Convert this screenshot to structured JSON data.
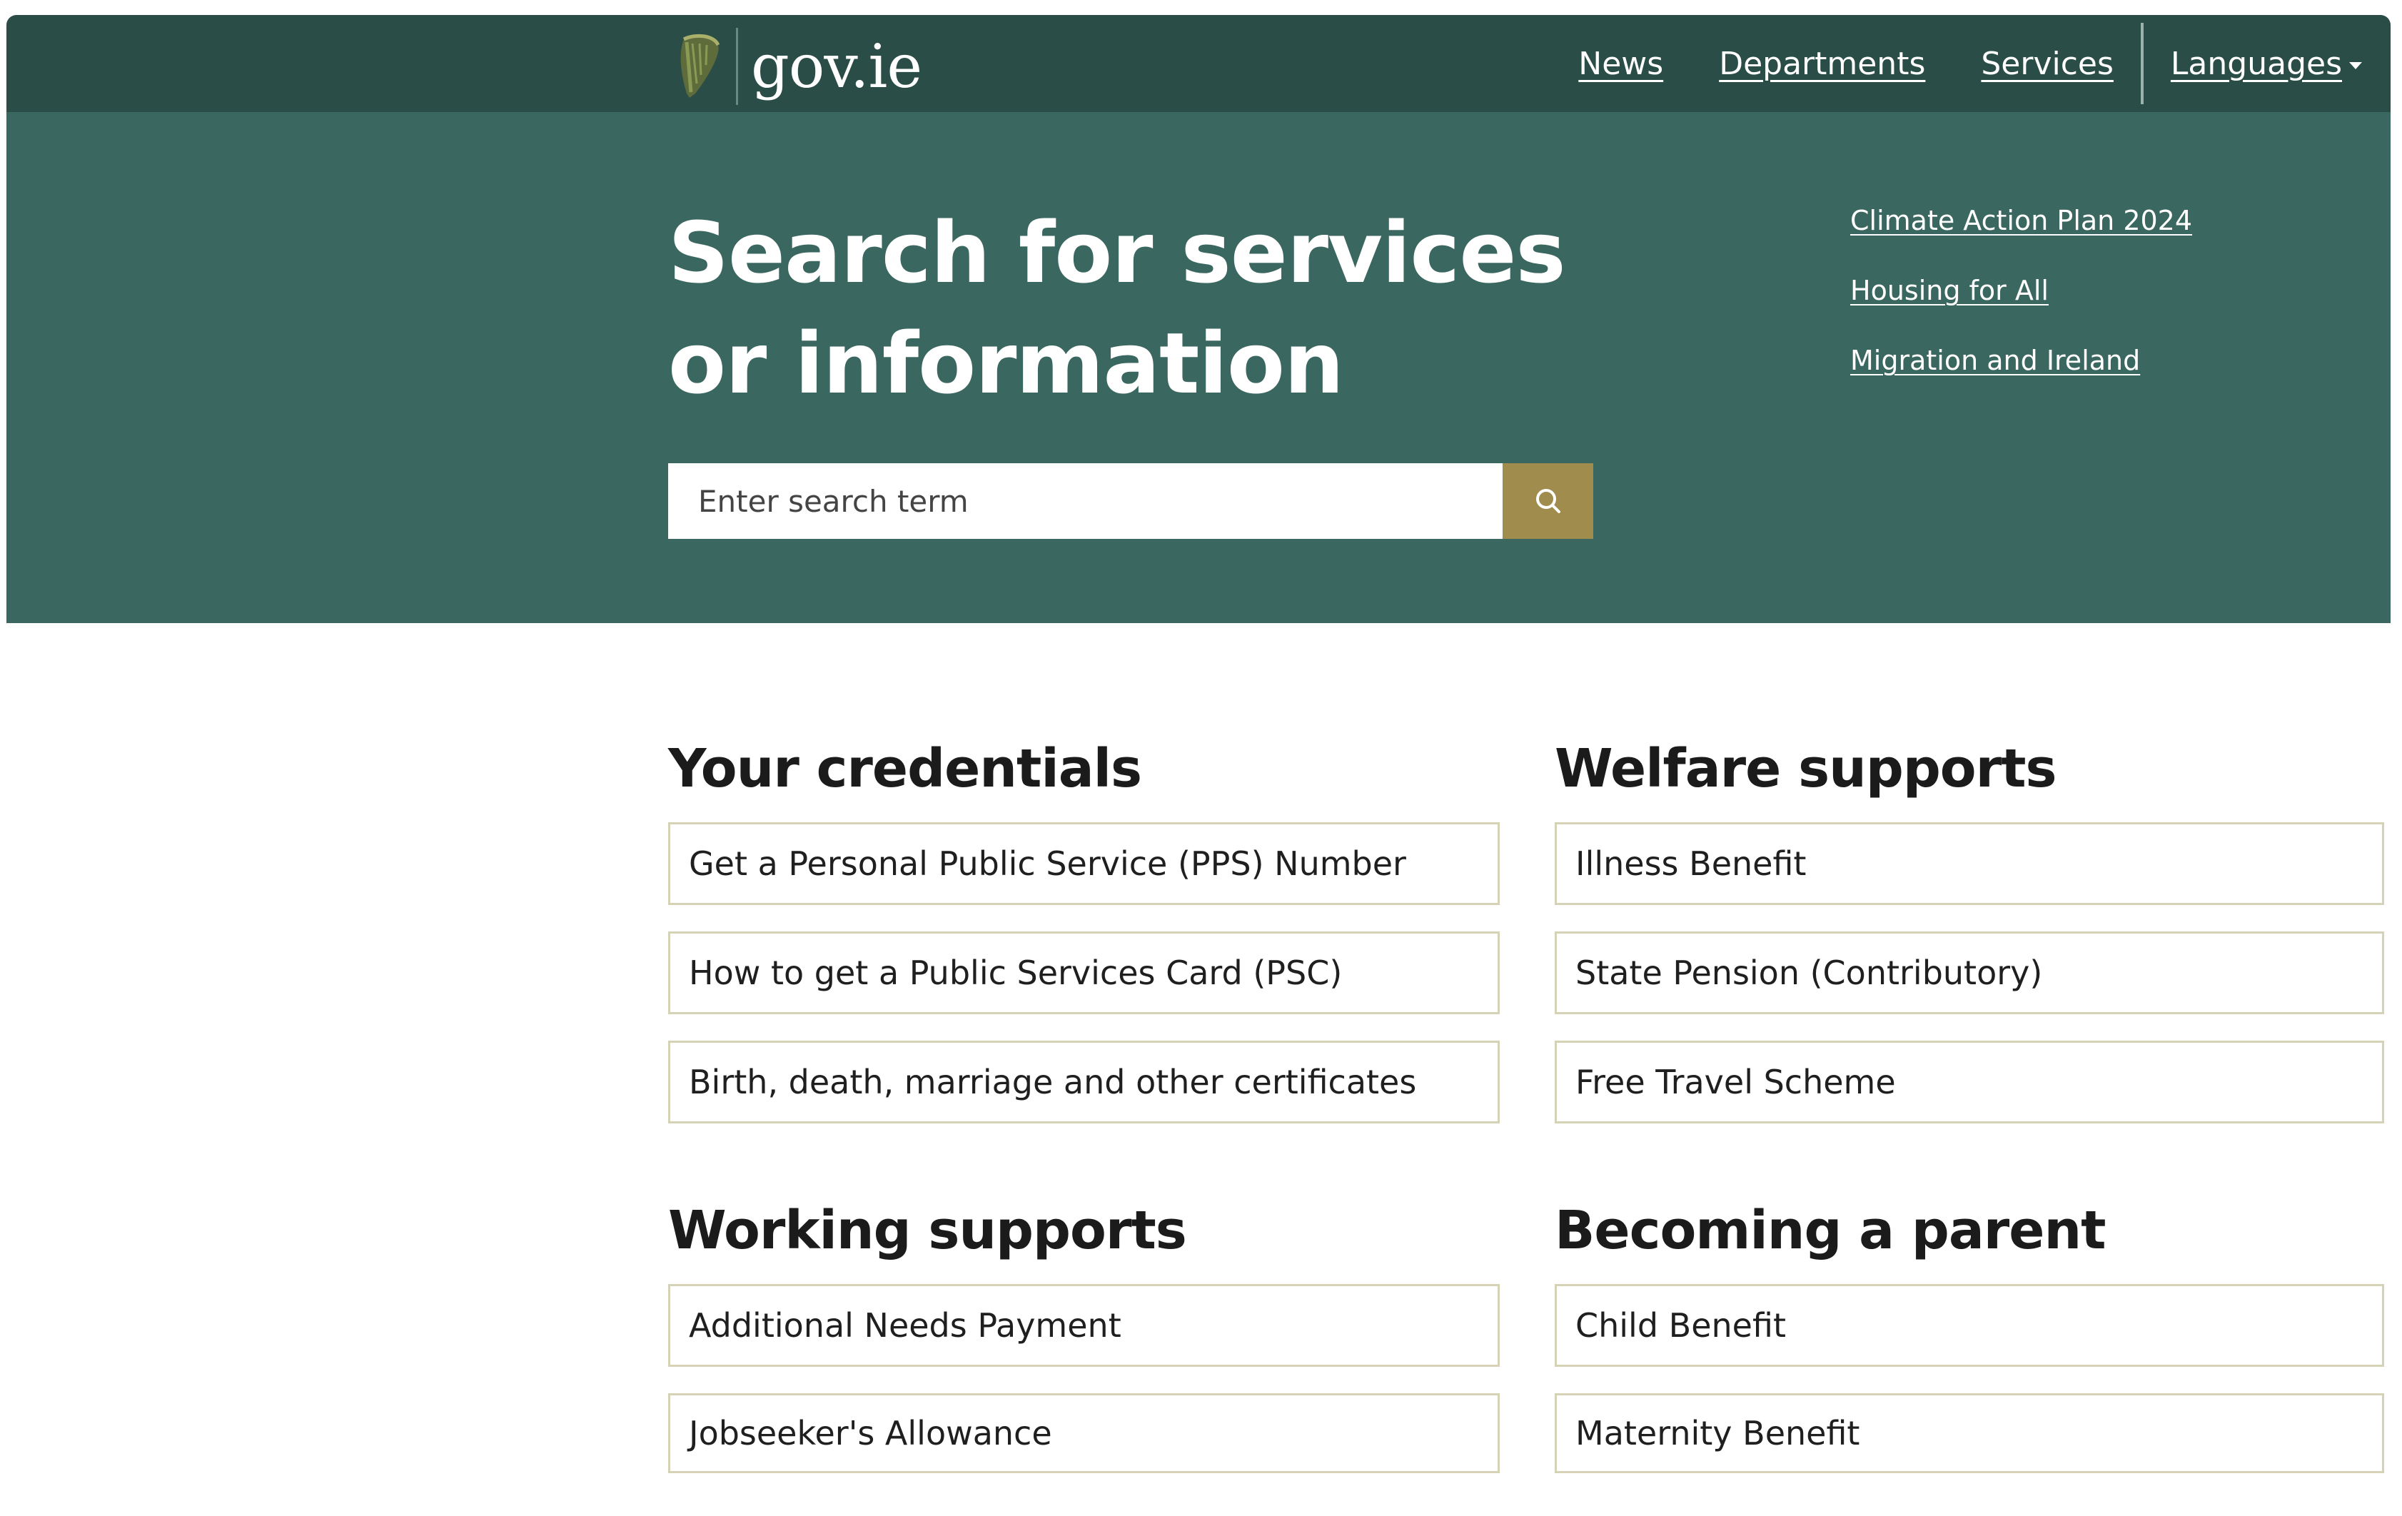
{
  "header": {
    "brand": "gov.ie",
    "nav": [
      {
        "label": "News"
      },
      {
        "label": "Departments"
      },
      {
        "label": "Services"
      }
    ],
    "languages_label": "Languages"
  },
  "hero": {
    "title_line1": "Search for services",
    "title_line2": "or information",
    "search_placeholder": "Enter search term",
    "quick_links": [
      {
        "label": "Climate Action Plan 2024"
      },
      {
        "label": "Housing for All"
      },
      {
        "label": "Migration and Ireland"
      }
    ]
  },
  "sections": {
    "credentials": {
      "title": "Your credentials",
      "items": [
        {
          "label": "Get a Personal Public Service (PPS) Number"
        },
        {
          "label": "How to get a Public Services Card (PSC)"
        },
        {
          "label": "Birth, death, marriage and other certificates"
        }
      ]
    },
    "welfare": {
      "title": "Welfare supports",
      "items": [
        {
          "label": "Illness Benefit"
        },
        {
          "label": "State Pension (Contributory)"
        },
        {
          "label": "Free Travel Scheme"
        }
      ]
    },
    "working": {
      "title": "Working supports",
      "items": [
        {
          "label": "Additional Needs Payment"
        },
        {
          "label": "Jobseeker's Allowance"
        }
      ]
    },
    "parent": {
      "title": "Becoming a parent",
      "items": [
        {
          "label": "Child Benefit"
        },
        {
          "label": "Maternity Benefit"
        }
      ]
    }
  },
  "colors": {
    "topbar": "#2b4d47",
    "hero": "#3b6761",
    "search_button": "#a08c4c",
    "card_border": "#d6d2b6"
  },
  "icons": {
    "logo": "harp-icon",
    "search": "search-icon",
    "dropdown": "caret-down-icon"
  }
}
